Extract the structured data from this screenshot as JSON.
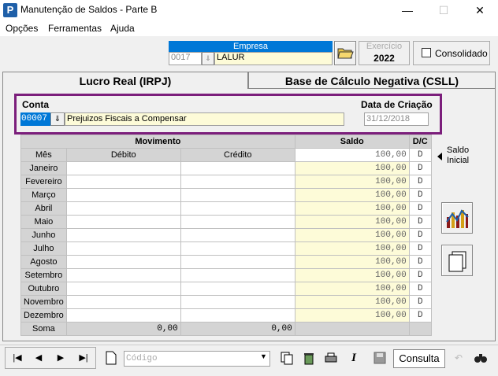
{
  "window": {
    "title": "Manutenção de Saldos - Parte B",
    "minimize": "—",
    "maximize": "☐",
    "close": "✕"
  },
  "menu": [
    "Opções",
    "Ferramentas",
    "Ajuda"
  ],
  "empresa": {
    "header": "Empresa",
    "code": "0017",
    "name": "LALUR"
  },
  "exercicio": {
    "label": "Exercício",
    "value": "2022"
  },
  "consolidado": {
    "label": "Consolidado",
    "checked": false
  },
  "tabs": [
    "Lucro Real (IRPJ)",
    "Base de Cálculo Negativa (CSLL)"
  ],
  "conta": {
    "label": "Conta",
    "code": "00007",
    "description": "Prejuizos Fiscais a Compensar"
  },
  "data_criacao": {
    "label": "Data de Criação",
    "value": "31/12/2018"
  },
  "grid": {
    "movimento_header": "Movimento",
    "saldo_header": "Saldo",
    "dc_header": "D/C",
    "mes_header": "Mês",
    "debito_header": "Débito",
    "credito_header": "Crédito",
    "rows": [
      {
        "mes": "Janeiro",
        "saldo": "100,00",
        "dc": "D"
      },
      {
        "mes": "Fevereiro",
        "saldo": "100,00",
        "dc": "D"
      },
      {
        "mes": "Março",
        "saldo": "100,00",
        "dc": "D"
      },
      {
        "mes": "Abril",
        "saldo": "100,00",
        "dc": "D"
      },
      {
        "mes": "Maio",
        "saldo": "100,00",
        "dc": "D"
      },
      {
        "mes": "Junho",
        "saldo": "100,00",
        "dc": "D"
      },
      {
        "mes": "Julho",
        "saldo": "100,00",
        "dc": "D"
      },
      {
        "mes": "Agosto",
        "saldo": "100,00",
        "dc": "D"
      },
      {
        "mes": "Setembro",
        "saldo": "100,00",
        "dc": "D"
      },
      {
        "mes": "Outubro",
        "saldo": "100,00",
        "dc": "D"
      },
      {
        "mes": "Novembro",
        "saldo": "100,00",
        "dc": "D"
      },
      {
        "mes": "Dezembro",
        "saldo": "100,00",
        "dc": "D"
      }
    ],
    "soma": {
      "label": "Soma",
      "debito": "0,00",
      "credito": "0,00"
    }
  },
  "saldo_inicial": {
    "line1": "Saldo",
    "line2": "Inicial"
  },
  "bottom": {
    "codigo_placeholder": "Código",
    "status": "Consulta"
  }
}
